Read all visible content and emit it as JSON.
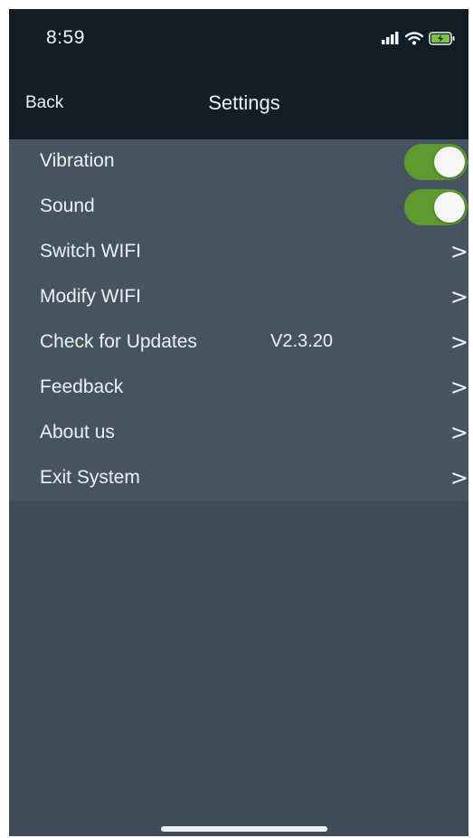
{
  "status_bar": {
    "time": "8:59",
    "icons": [
      "signal-icon",
      "wifi-icon",
      "battery-charging-icon"
    ]
  },
  "nav": {
    "back_label": "Back",
    "title": "Settings"
  },
  "settings": {
    "items": [
      {
        "label": "Vibration",
        "control": "toggle",
        "on": true
      },
      {
        "label": "Sound",
        "control": "toggle",
        "on": true
      },
      {
        "label": "Switch WIFI",
        "control": "chevron",
        "chevron": ">"
      },
      {
        "label": "Modify WIFI",
        "control": "chevron",
        "chevron": ">"
      },
      {
        "label": "Check for Updates",
        "value": "V2.3.20",
        "control": "chevron",
        "chevron": ">"
      },
      {
        "label": "Feedback",
        "control": "chevron",
        "chevron": ">"
      },
      {
        "label": "About us",
        "control": "chevron",
        "chevron": ">"
      },
      {
        "label": "Exit System",
        "control": "chevron",
        "chevron": ">"
      }
    ]
  },
  "colors": {
    "header_bg": "#121d25",
    "list_bg": "#465461",
    "screen_bg": "#3f4c59",
    "toggle_on": "#5e9b2e",
    "battery_fill": "#7bc043"
  }
}
